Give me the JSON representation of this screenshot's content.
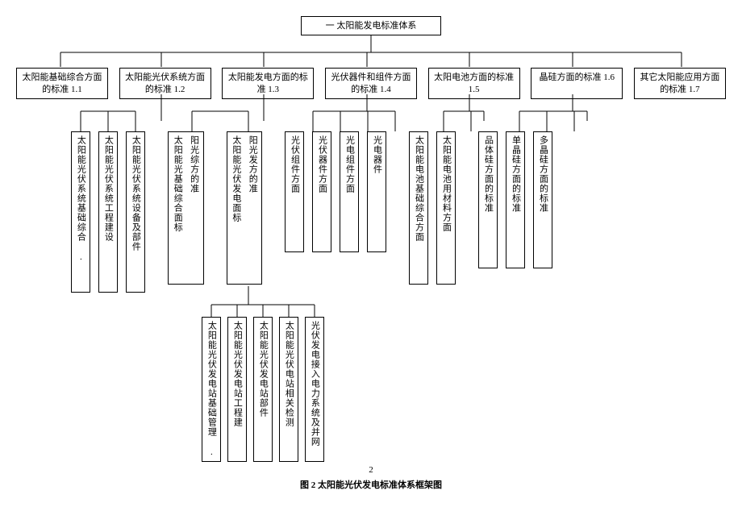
{
  "root": {
    "label": "一  太阳能发电标准体系"
  },
  "level2": [
    {
      "label": "太阳能基础综合方面的标准 1.1"
    },
    {
      "label": "太阳能光伏系统方面的标准 1.2"
    },
    {
      "label": "太阳能发电方面的标准 1.3"
    },
    {
      "label": "光伏器件和组件方面的标准 1.4"
    },
    {
      "label": "太阳电池方面的标准 1.5"
    },
    {
      "label": "晶硅方面的标准 1.6"
    },
    {
      "label": "其它太阳能应用方面的标准 1.7"
    }
  ],
  "level3": {
    "g1_2": [
      {
        "label": "太阳能光伏系统基础综合 ."
      },
      {
        "label": "太阳能光伏系统工程建设"
      },
      {
        "label": "太阳能光伏系统设备及部件"
      }
    ],
    "g1_3": [
      {
        "label": "太阳能光基础综合面标",
        "right": "阳光综方的准"
      },
      {
        "label": "太阳能光伏发电面标",
        "right": "阳光发方的准"
      }
    ],
    "g1_4": [
      {
        "label": "光伏组件方面"
      },
      {
        "label": "光伏器件方面"
      },
      {
        "label": "光电组件方面"
      },
      {
        "label": "光电器件"
      }
    ],
    "g1_5": [
      {
        "label": "太阳能电池基础综合方面"
      },
      {
        "label": "太阳能电池用材料方面"
      }
    ],
    "g1_6": [
      {
        "label": "品体硅方面的标准"
      },
      {
        "label": "单晶硅方面的标准"
      },
      {
        "label": "多晶硅方面的标准"
      }
    ]
  },
  "level4": {
    "g1_3_2": [
      {
        "label": "太阳能光伏发电站基础管理 ."
      },
      {
        "label": "太阳能光伏发电站工程建"
      },
      {
        "label": "太阳能光伏发电站部件"
      },
      {
        "label": "太阳能光伏电站相关检测"
      },
      {
        "label": "光伏发电接入电力系统及并网"
      }
    ]
  },
  "page_number": "2",
  "caption": "图 2 太阳能光伏发电标准体系框架图"
}
